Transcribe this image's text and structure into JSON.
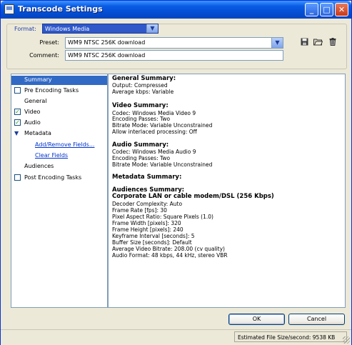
{
  "window": {
    "title": "Transcode Settings"
  },
  "titlebar_buttons": {
    "minimize": "_",
    "maximize": "□",
    "close": "✕"
  },
  "format": {
    "label": "Format:",
    "value": "Windows Media",
    "preset_label": "Preset:",
    "preset_value": "WM9 NTSC 256K download",
    "comment_label": "Comment:",
    "comment_value": "WM9 NTSC 256K download",
    "icons": [
      "save-icon",
      "open-folder-icon",
      "trash-icon"
    ]
  },
  "tree": {
    "items": [
      {
        "label": "Summary",
        "kind": "plain",
        "selected": true
      },
      {
        "label": "Pre Encoding Tasks",
        "kind": "checkbox",
        "checked": false
      },
      {
        "label": "General",
        "kind": "plain"
      },
      {
        "label": "Video",
        "kind": "checkbox",
        "checked": true
      },
      {
        "label": "Audio",
        "kind": "checkbox",
        "checked": true
      },
      {
        "label": "Metadata",
        "kind": "expanded"
      },
      {
        "label": "Add/Remove Fields...",
        "kind": "link"
      },
      {
        "label": "Clear Fields",
        "kind": "link"
      },
      {
        "label": "Audiences",
        "kind": "plain"
      },
      {
        "label": "Post Encoding Tasks",
        "kind": "checkbox",
        "checked": false
      }
    ]
  },
  "summary": {
    "general_heading": "General Summary:",
    "general_lines": [
      "Output: Compressed",
      "Average kbps: Variable"
    ],
    "video_heading": "Video Summary:",
    "video_lines": [
      "Codec: Windows Media Video 9",
      "Encoding Passes: Two",
      "Bitrate Mode: Variable Unconstrained",
      "Allow interlaced processing: Off"
    ],
    "audio_heading": "Audio Summary:",
    "audio_lines": [
      "Codec: Windows Media Audio 9",
      "Encoding Passes: Two",
      "Bitrate Mode: Variable Unconstrained"
    ],
    "metadata_heading": "Metadata Summary:",
    "audiences_heading": "Audiences Summary:",
    "audience_name": "Corporate LAN or cable modem/DSL (256 Kbps)",
    "audience_lines": [
      "Decoder Complexity: Auto",
      "Frame Rate [fps]: 30",
      "Pixel Aspect Ratio: Square Pixels (1.0)",
      "Frame Width [pixels]: 320",
      "Frame Height [pixels]: 240",
      "Keyframe Interval [seconds]: 5",
      "Buffer Size [seconds]: Default",
      "Average Video Bitrate: 208.00 (cv quality)",
      "Audio Format: 48 kbps, 44 kHz, stereo VBR"
    ]
  },
  "buttons": {
    "ok": "OK",
    "cancel": "Cancel"
  },
  "status": {
    "estimate": "Estimated File Size/second: 9538 KB"
  }
}
